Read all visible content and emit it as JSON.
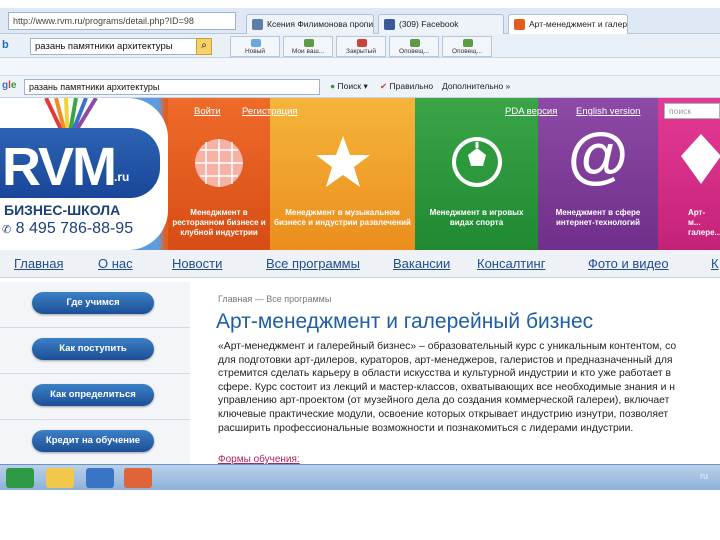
{
  "browser": {
    "url": "http://www.rvm.ru/programs/detail.php?ID=98",
    "tabs": [
      {
        "label": "Ксения Филимонова прописа..."
      },
      {
        "label": "(309) Facebook"
      },
      {
        "label": "Арт-менеджмент и галерей..."
      }
    ],
    "bing_search": "разань памятники архитектуры",
    "toolbar_buttons": [
      "Новый",
      "Мои ваш...",
      "Закрытый",
      "Оповещ...",
      "Оповещ..."
    ],
    "google_search": "разань памятники архитектуры",
    "google_items": [
      "Поиск",
      "Правильно",
      "Дополнительно »"
    ]
  },
  "site": {
    "logo_text": "RVM",
    "logo_suffix": ".ru",
    "school_label": "БИЗНЕС-ШКОЛА",
    "phone": "8 495 786-88-95",
    "top_links": {
      "login": "Войти",
      "register": "Регистрация",
      "pda": "PDA версия",
      "english": "English version"
    },
    "search_placeholder": "поиск",
    "panels": [
      {
        "caption": "Менеджмент в ресторанном бизнесе и клубной индустрии",
        "icon": "disco-ball-icon"
      },
      {
        "caption": "Менеджмент в музыкальном бизнесе и индустрии развлечений",
        "icon": "star-icon"
      },
      {
        "caption": "Менеджмент в игровых видах спорта",
        "icon": "football-icon"
      },
      {
        "caption": "Менеджмент в сфере интернет-технологий",
        "icon": "at-sign-icon"
      },
      {
        "caption": "Арт-м... галере...",
        "icon": "diamond-icon"
      }
    ],
    "nav": [
      "Главная",
      "О нас",
      "Новости",
      "Все программы",
      "Вакансии",
      "Консалтинг",
      "Фото и видео",
      "К"
    ],
    "sidebar_buttons": [
      "Где учимся",
      "Как поступить",
      "Как определиться",
      "Кредит на обучение"
    ],
    "breadcrumb": "Главная — Все программы",
    "title": "Арт-менеджмент и галерейный бизнес",
    "paragraph": [
      "«Арт-менеджмент и галерейный бизнес» – образовательный курс с уникальным контентом, со",
      "для подготовки арт-дилеров, кураторов, арт-менеджеров, галеристов и предназначенный для",
      "стремится сделать карьеру в области искусства и культурной индустрии и кто уже работает в",
      "сфере. Курс состоит из лекций и мастер-классов, охватывающих все необходимые знания и н",
      "управлению арт-проектом (от музейного дела до создания коммерческой галереи), включает",
      "ключевые практические модули, освоение которых открывает индустрию изнутри, позволяет",
      "расширить профессиональные возможности и познакомиться с лидерами индустрии."
    ],
    "forms_link": "Формы обучения:"
  },
  "taskbar": {
    "tray_text": "ru",
    "icons": [
      "utorrent-icon",
      "folder-icon",
      "internet-explorer-icon",
      "powerpoint-icon"
    ]
  },
  "colors": {
    "title_blue": "#1f5da8",
    "nav_blue": "#1f4f8f",
    "orange": "#ef6b2a",
    "green": "#2c9a3c",
    "purple": "#8d4aa6",
    "magenta": "#e53a95"
  }
}
